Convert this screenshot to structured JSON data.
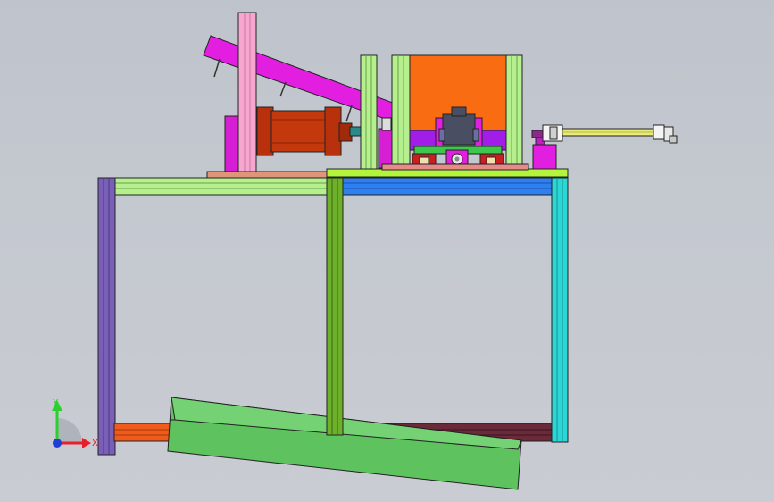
{
  "axes": {
    "x_label": "X",
    "y_label": "Y",
    "x_color": "#e8202a",
    "y_color": "#2bd12b",
    "z_color": "#1f3fd8"
  },
  "colors": {
    "background": "#c4c8cf",
    "pink_post": "#f7a6cf",
    "magenta_ramp": "#e21ee0",
    "cylinder": "#c4380e",
    "orange_block": "#fa6c12",
    "light_green_post": "#b6f08e",
    "lime_top": "#b2f53a",
    "cyan_frame": "#2ad6d6",
    "blue_beam": "#2e7ff0",
    "purple_leg": "#7a5fb8",
    "green_chute": "#5ec25e",
    "maroon_beam": "#6a2a3a",
    "olive_leg": "#6fb02a",
    "yellow_rod": "#e8ea7a"
  }
}
